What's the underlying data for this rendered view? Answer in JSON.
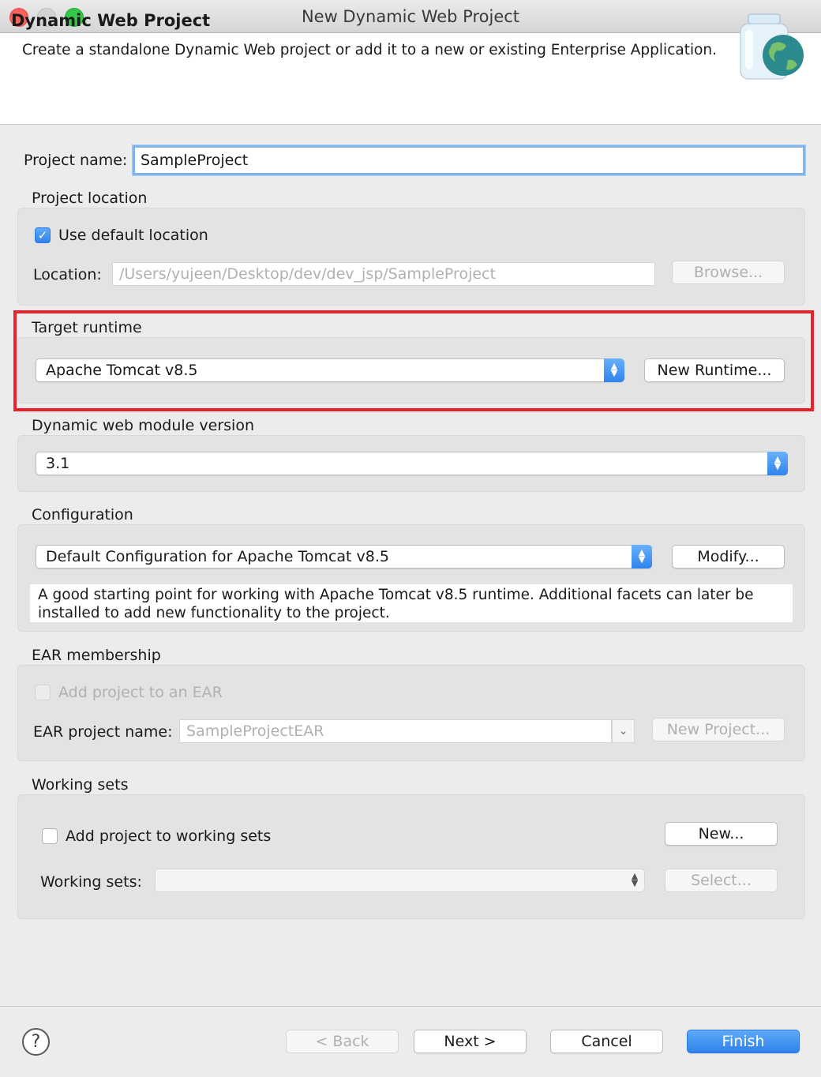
{
  "window": {
    "title": "New Dynamic Web Project"
  },
  "banner": {
    "title": "Dynamic Web Project",
    "description": "Create a standalone Dynamic Web project or add it to a new or existing Enterprise Application."
  },
  "project_name": {
    "label": "Project name:",
    "value": "SampleProject"
  },
  "project_location": {
    "heading": "Project location",
    "use_default_label": "Use default location",
    "use_default_checked": true,
    "location_label": "Location:",
    "location_value": "/Users/yujeen/Desktop/dev/dev_jsp/SampleProject",
    "browse_label": "Browse..."
  },
  "target_runtime": {
    "heading": "Target runtime",
    "selected": "Apache Tomcat v8.5",
    "new_runtime_label": "New Runtime..."
  },
  "web_module": {
    "heading": "Dynamic web module version",
    "selected": "3.1"
  },
  "configuration": {
    "heading": "Configuration",
    "selected": "Default Configuration for Apache Tomcat v8.5",
    "modify_label": "Modify...",
    "description": "A good starting point for working with Apache Tomcat v8.5 runtime. Additional facets can later be installed to add new functionality to the project."
  },
  "ear": {
    "heading": "EAR membership",
    "add_label": "Add project to an EAR",
    "add_checked": false,
    "name_label": "EAR project name:",
    "name_value": "SampleProjectEAR",
    "new_project_label": "New Project..."
  },
  "working_sets": {
    "heading": "Working sets",
    "add_label": "Add project to working sets",
    "add_checked": false,
    "new_label": "New...",
    "sets_label": "Working sets:",
    "sets_value": "",
    "select_label": "Select..."
  },
  "footer": {
    "help_glyph": "?",
    "back_label": "< Back",
    "next_label": "Next >",
    "cancel_label": "Cancel",
    "finish_label": "Finish"
  },
  "colors": {
    "accent": "#2f82ea",
    "highlight": "#e8212a",
    "close": "#fc605b",
    "maximize": "#34c84a"
  }
}
